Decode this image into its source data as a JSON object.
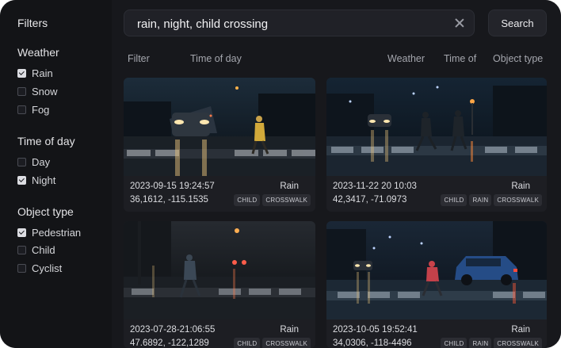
{
  "sidebar": {
    "title": "Filters",
    "groups": [
      {
        "title": "Weather",
        "options": [
          {
            "label": "Rain",
            "checked": true
          },
          {
            "label": "Snow",
            "checked": false
          },
          {
            "label": "Fog",
            "checked": false
          }
        ]
      },
      {
        "title": "Time of day",
        "options": [
          {
            "label": "Day",
            "checked": false
          },
          {
            "label": "Night",
            "checked": true
          }
        ]
      },
      {
        "title": "Object type",
        "options": [
          {
            "label": "Pedestrian",
            "checked": true
          },
          {
            "label": "Child",
            "checked": false
          },
          {
            "label": "Cyclist",
            "checked": false
          }
        ]
      }
    ]
  },
  "search": {
    "value": "rain, night, child crossing",
    "button_label": "Search"
  },
  "columns": {
    "filter": "Filter",
    "time_of_day": "Time of day",
    "weather": "Weather",
    "time_of": "Time of",
    "object_type": "Object type"
  },
  "results": [
    {
      "timestamp": "2023-09-15 19:24:57",
      "weather": "Rain",
      "coords": "36,1612, -115.1535",
      "tags": [
        "CHILD",
        "CROSSWALK"
      ]
    },
    {
      "timestamp": "2023-11-22 20 10:03",
      "weather": "Rain",
      "coords": "42,3417, -71.0973",
      "tags": [
        "CHILD",
        "RAIN",
        "CROSSWALK"
      ]
    },
    {
      "timestamp": "2023-07-28-21:06:55",
      "weather": "Rain",
      "coords": "47.6892, -122,1289",
      "tags": [
        "CHILD",
        "CROSSWALK"
      ]
    },
    {
      "timestamp": "2023-10-05 19:52:41",
      "weather": "Rain",
      "coords": "34,0306, -118-4496",
      "tags": [
        "CHILD",
        "RAIN",
        "CROSSWALK"
      ]
    }
  ]
}
